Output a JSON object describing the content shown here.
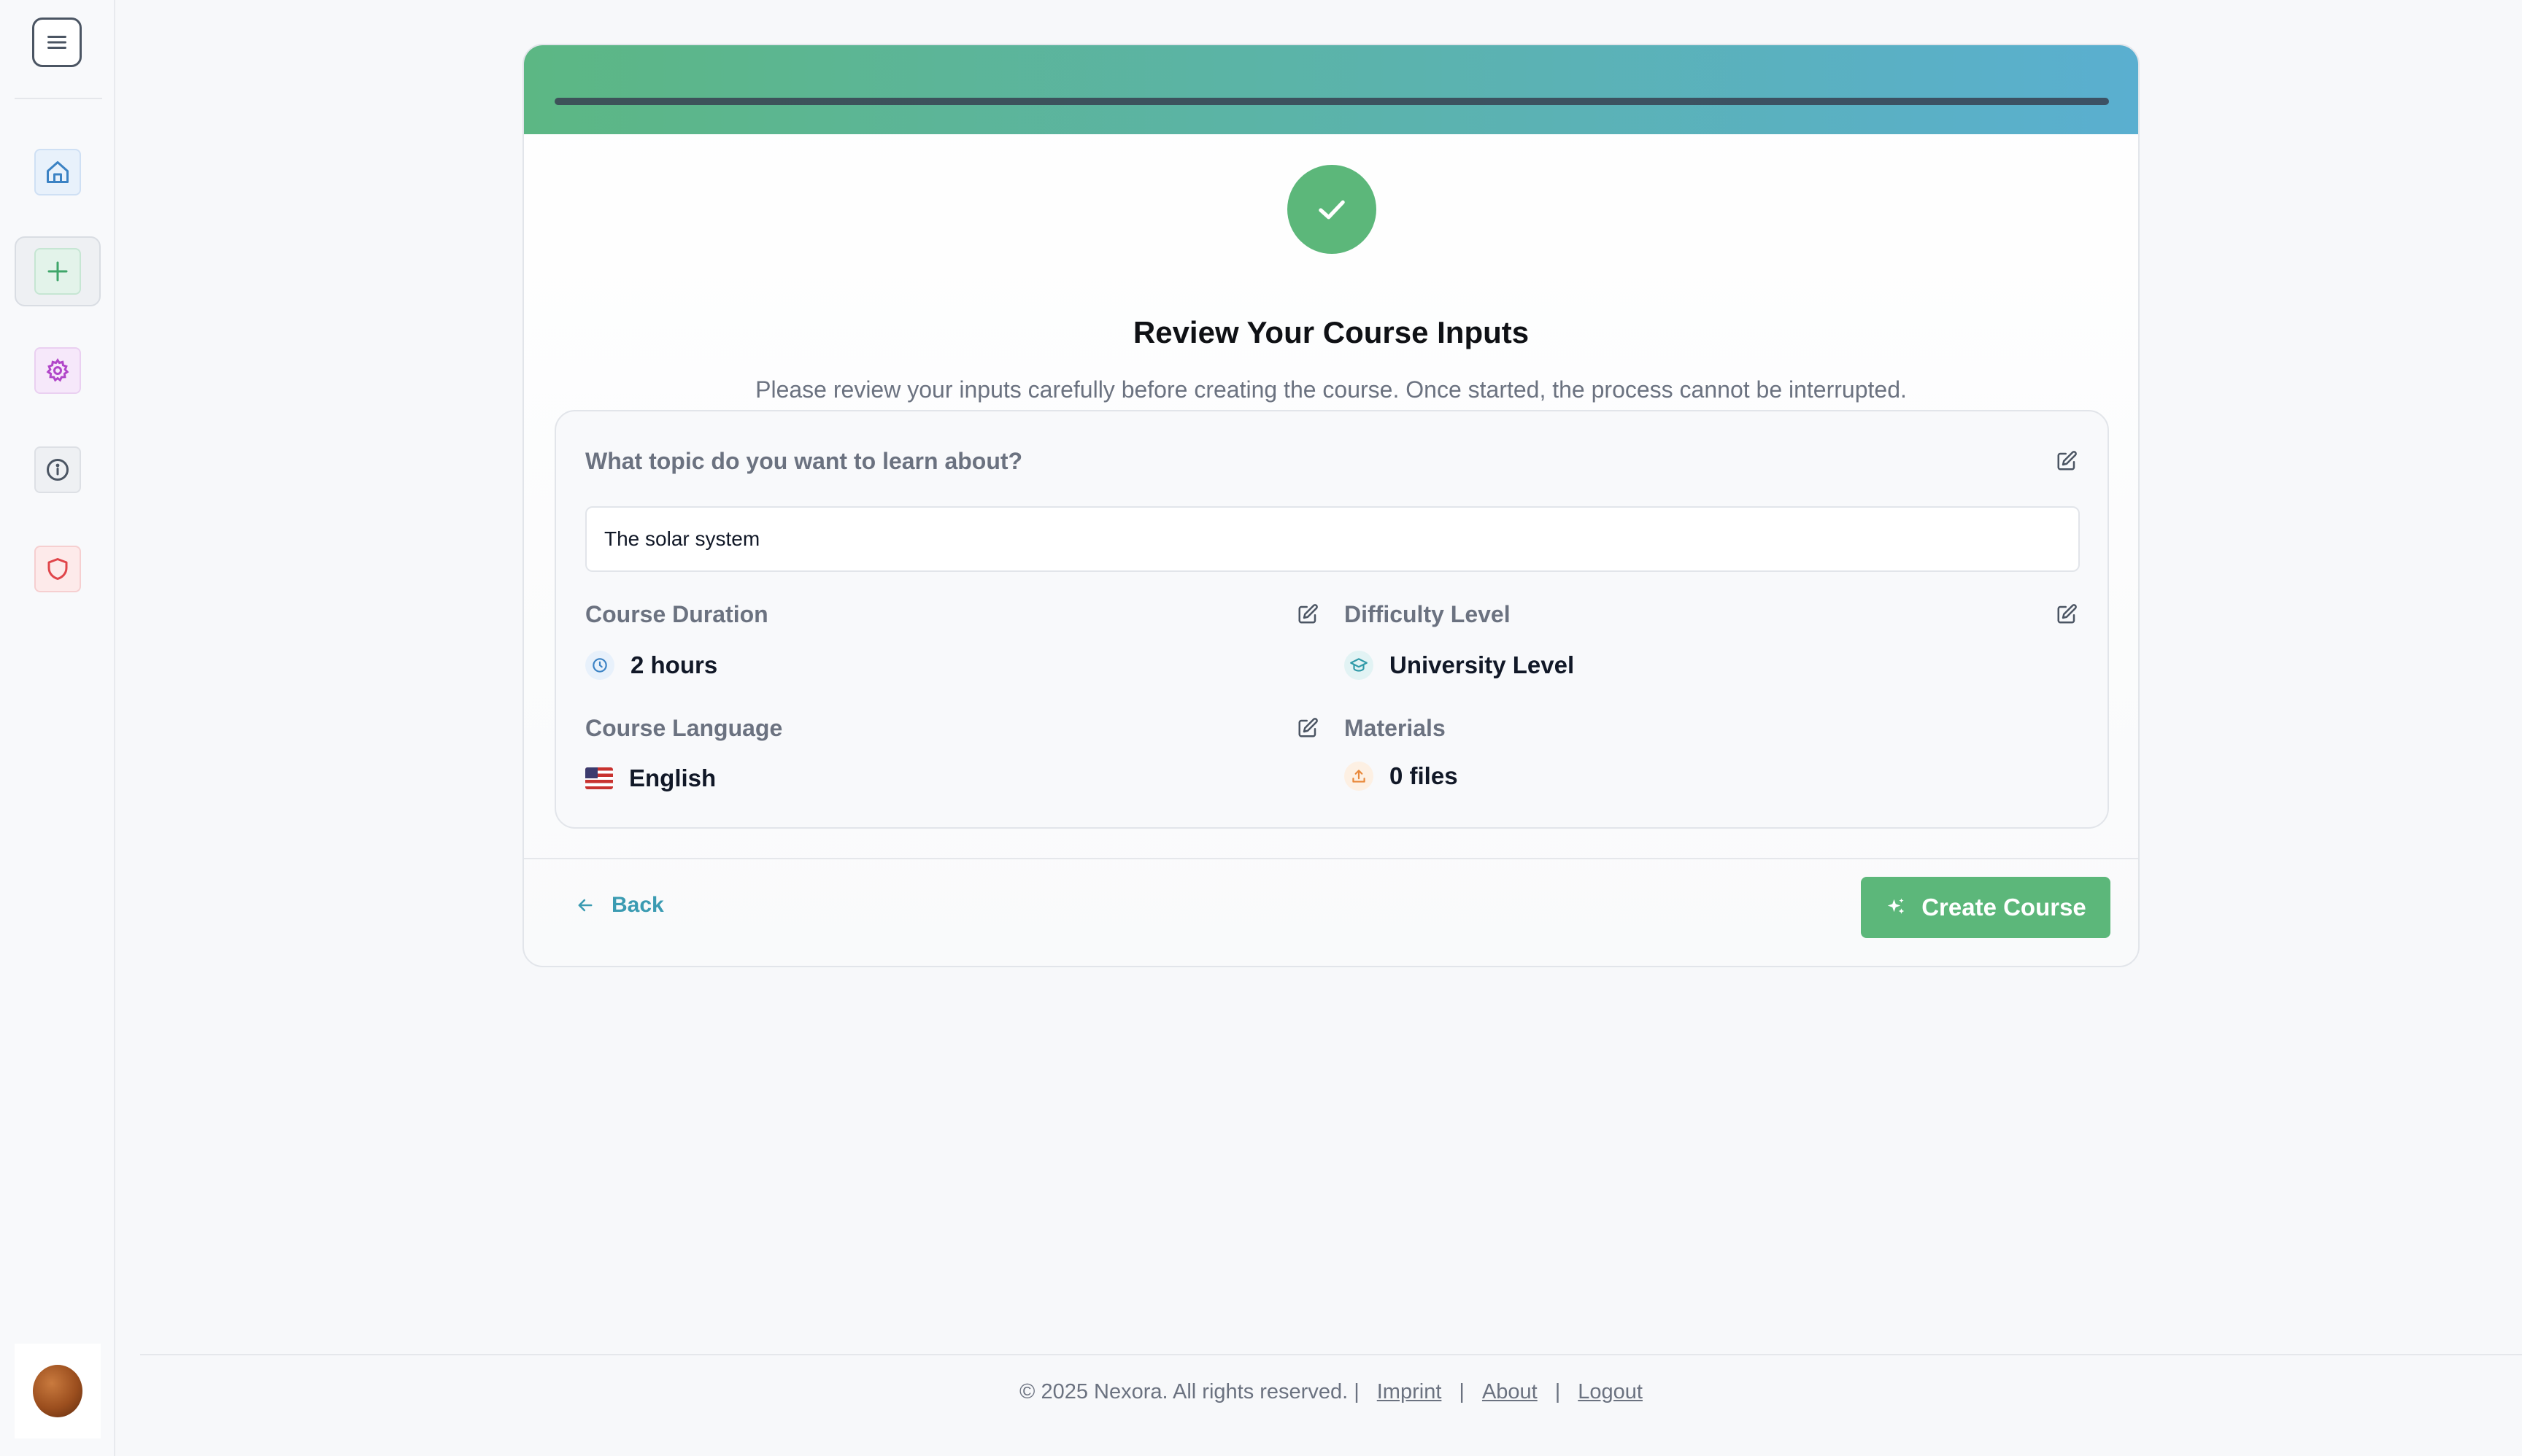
{
  "sidebar": {
    "items": [
      {
        "name": "home",
        "icon": "home-icon",
        "color": "#3b82c4",
        "bg": "#e8f1fb"
      },
      {
        "name": "create",
        "icon": "plus-icon",
        "color": "#3fa66a",
        "bg": "#e3f3ea",
        "active": true
      },
      {
        "name": "settings",
        "icon": "gear-icon",
        "color": "#b146c9",
        "bg": "#f6e8fa"
      },
      {
        "name": "info",
        "icon": "info-icon",
        "color": "#4b5563",
        "bg": "#eef0f3"
      },
      {
        "name": "privacy",
        "icon": "shield-icon",
        "color": "#e0454a",
        "bg": "#fdeaea"
      }
    ]
  },
  "card": {
    "title": "Review Your Course Inputs",
    "subtitle": "Please review your inputs carefully before creating the course. Once started, the process cannot be interrupted.",
    "accent_color": "#5cb77a"
  },
  "topic": {
    "label": "What topic do you want to learn about?",
    "value": "The solar system"
  },
  "duration": {
    "label": "Course Duration",
    "value": "2 hours"
  },
  "difficulty": {
    "label": "Difficulty Level",
    "value": "University Level"
  },
  "language": {
    "label": "Course Language",
    "value": "English"
  },
  "materials": {
    "label": "Materials",
    "value": "0 files"
  },
  "actions": {
    "back_label": "Back",
    "create_label": "Create Course"
  },
  "footer": {
    "copyright": "© 2025 Nexora. All rights reserved. |",
    "sep": "|",
    "links": [
      "Imprint",
      "About",
      "Logout"
    ]
  }
}
